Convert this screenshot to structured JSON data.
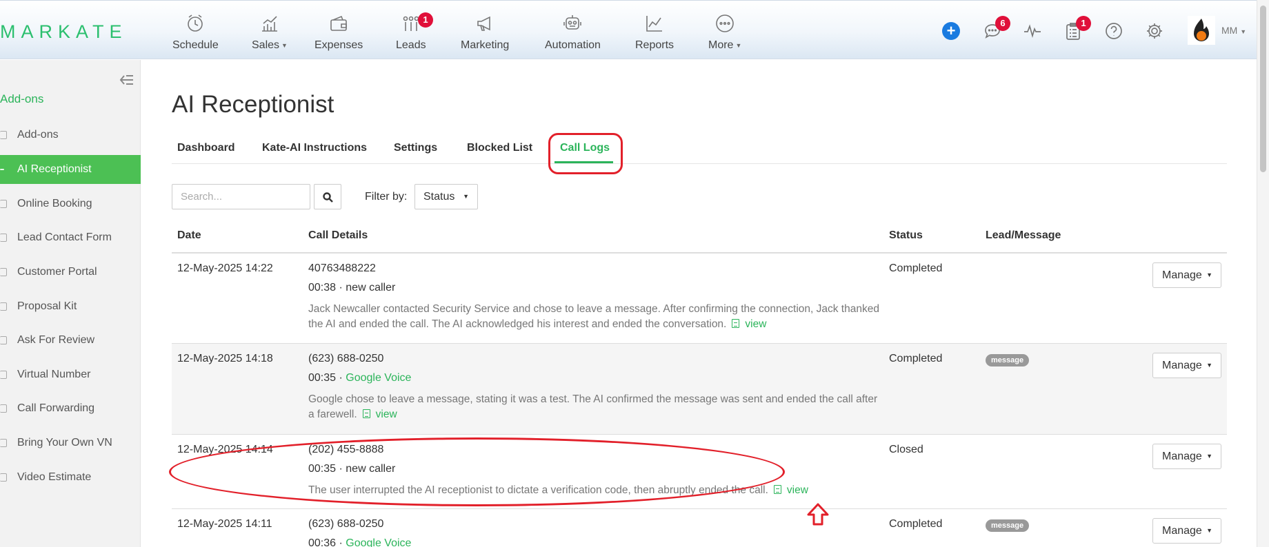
{
  "brand": {
    "logo": "MARKATE",
    "accent": "#2bb45a",
    "alert": "#e0103a",
    "highlight": "#e2202a"
  },
  "nav": [
    {
      "label": "Schedule",
      "icon": "clock-icon"
    },
    {
      "label": "Sales",
      "icon": "sales-chart-icon",
      "caret": true
    },
    {
      "label": "Expenses",
      "icon": "wallet-icon"
    },
    {
      "label": "Leads",
      "icon": "leads-icon",
      "badge": "1"
    },
    {
      "label": "Marketing",
      "icon": "megaphone-icon"
    },
    {
      "label": "Automation",
      "icon": "robot-icon"
    },
    {
      "label": "Reports",
      "icon": "reports-chart-icon"
    },
    {
      "label": "More",
      "icon": "more-dots-icon",
      "caret": true
    }
  ],
  "header_right": {
    "chat_badge": "6",
    "tasks_badge": "1",
    "user_initials": "MM"
  },
  "sidebar": {
    "heading": "Add-ons",
    "items": [
      {
        "label": "Add-ons"
      },
      {
        "label": "AI Receptionist",
        "active": true
      },
      {
        "label": "Online Booking"
      },
      {
        "label": "Lead Contact Form"
      },
      {
        "label": "Customer Portal"
      },
      {
        "label": "Proposal Kit"
      },
      {
        "label": "Ask For Review"
      },
      {
        "label": "Virtual Number"
      },
      {
        "label": "Call Forwarding"
      },
      {
        "label": "Bring Your Own VN"
      },
      {
        "label": "Video Estimate"
      }
    ]
  },
  "page": {
    "title": "AI Receptionist",
    "tabs": [
      "Dashboard",
      "Kate-AI Instructions",
      "Settings",
      "Blocked List",
      "Call Logs"
    ],
    "active_tab": "Call Logs",
    "search": {
      "placeholder": "Search..."
    },
    "filter": {
      "label": "Filter by:",
      "selected": "Status"
    }
  },
  "table": {
    "headers": {
      "date": "Date",
      "details": "Call Details",
      "status": "Status",
      "lead": "Lead/Message"
    },
    "manage_label": "Manage",
    "view_label": "view",
    "rows": [
      {
        "date": "12-May-2025 14:22",
        "number": "40763488222",
        "duration": "00:38",
        "caller": "new caller",
        "summary": "Jack Newcaller contacted Security Service and chose to leave a message. After confirming the connection, Jack thanked the AI and ended the call. The AI acknowledged his interest and ended the conversation.",
        "status": "Completed",
        "lead": ""
      },
      {
        "date": "12-May-2025 14:18",
        "number": "(623) 688-0250",
        "duration": "00:35",
        "caller": "Google Voice",
        "summary": "Google chose to leave a message, stating it was a test. The AI confirmed the message was sent and ended the call after a farewell.",
        "status": "Completed",
        "lead": "message"
      },
      {
        "date": "12-May-2025 14:14",
        "number": "(202) 455-8888",
        "duration": "00:35",
        "caller": "new caller",
        "summary": "The user interrupted the AI receptionist to dictate a verification code, then abruptly ended the call.",
        "status": "Closed",
        "lead": ""
      },
      {
        "date": "12-May-2025 14:11",
        "number": "(623) 688-0250",
        "duration": "00:36",
        "caller": "Google Voice",
        "summary": "",
        "status": "Completed",
        "lead": "message"
      }
    ]
  }
}
